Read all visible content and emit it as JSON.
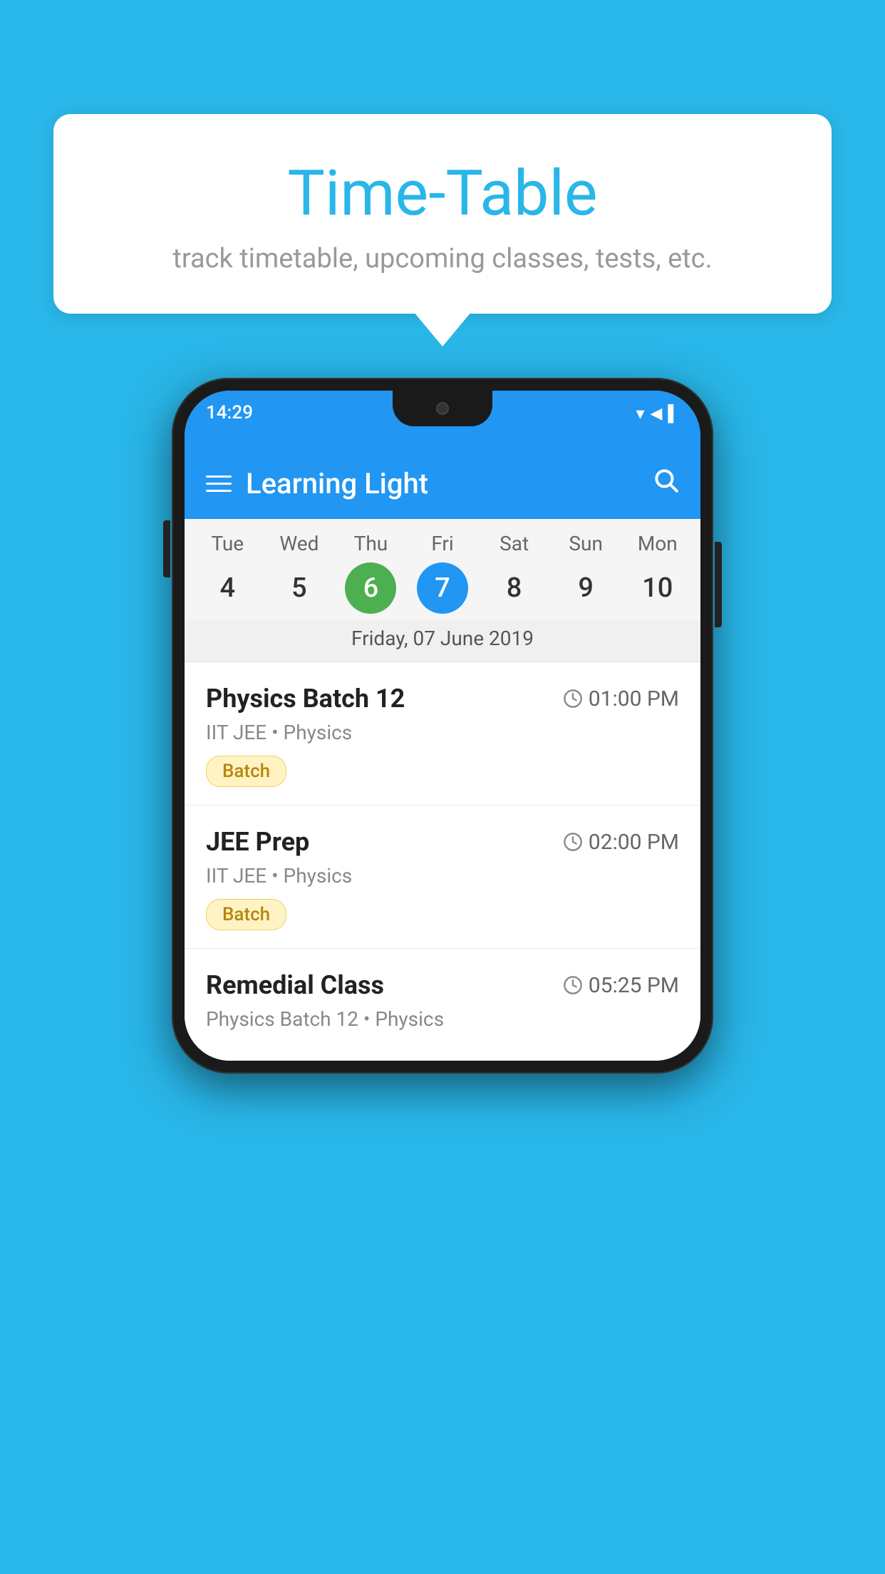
{
  "background": {
    "color": "#29b6e8"
  },
  "bubble": {
    "title": "Time-Table",
    "subtitle": "track timetable, upcoming classes, tests, etc."
  },
  "status_bar": {
    "time": "14:29",
    "wifi": "▾",
    "signal": "▲",
    "battery": "▌"
  },
  "app_bar": {
    "title": "Learning Light",
    "search_label": "search"
  },
  "calendar": {
    "days": [
      {
        "name": "Tue",
        "num": "4",
        "state": "normal"
      },
      {
        "name": "Wed",
        "num": "5",
        "state": "normal"
      },
      {
        "name": "Thu",
        "num": "6",
        "state": "today"
      },
      {
        "name": "Fri",
        "num": "7",
        "state": "selected"
      },
      {
        "name": "Sat",
        "num": "8",
        "state": "normal"
      },
      {
        "name": "Sun",
        "num": "9",
        "state": "normal"
      },
      {
        "name": "Mon",
        "num": "10",
        "state": "normal"
      }
    ],
    "selected_date_label": "Friday, 07 June 2019"
  },
  "schedule": {
    "items": [
      {
        "name": "Physics Batch 12",
        "time": "01:00 PM",
        "meta": "IIT JEE • Physics",
        "badge": "Batch"
      },
      {
        "name": "JEE Prep",
        "time": "02:00 PM",
        "meta": "IIT JEE • Physics",
        "badge": "Batch"
      },
      {
        "name": "Remedial Class",
        "time": "05:25 PM",
        "meta": "Physics Batch 12 • Physics",
        "badge": ""
      }
    ]
  }
}
